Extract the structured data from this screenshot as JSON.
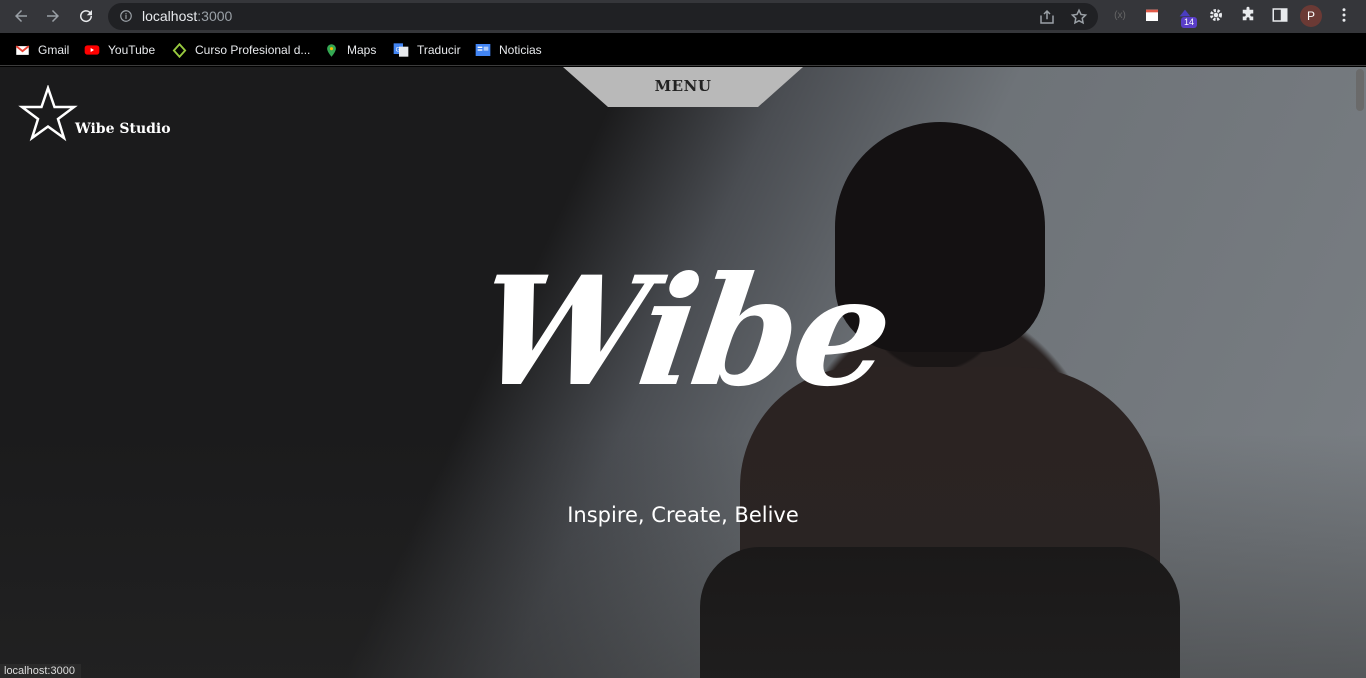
{
  "browser": {
    "url_host": "localhost",
    "url_port": ":3000",
    "extension_badge": "14",
    "profile_initial": "P"
  },
  "bookmarks": [
    {
      "label": "Gmail",
      "icon": "gmail-icon"
    },
    {
      "label": "YouTube",
      "icon": "youtube-icon"
    },
    {
      "label": "Curso Profesional d...",
      "icon": "course-icon"
    },
    {
      "label": "Maps",
      "icon": "maps-icon"
    },
    {
      "label": "Traducir",
      "icon": "translate-icon"
    },
    {
      "label": "Noticias",
      "icon": "news-icon"
    }
  ],
  "site": {
    "menu_label": "MENU",
    "logo_text": "Wibe Studio",
    "hero_title": "Wibe",
    "tagline": "Inspire, Create, Belive"
  },
  "status_url": "localhost:3000",
  "colors": {
    "menu_tab": "#b9b9b9",
    "chrome_bar": "#35363a",
    "omnibox": "#202124"
  }
}
